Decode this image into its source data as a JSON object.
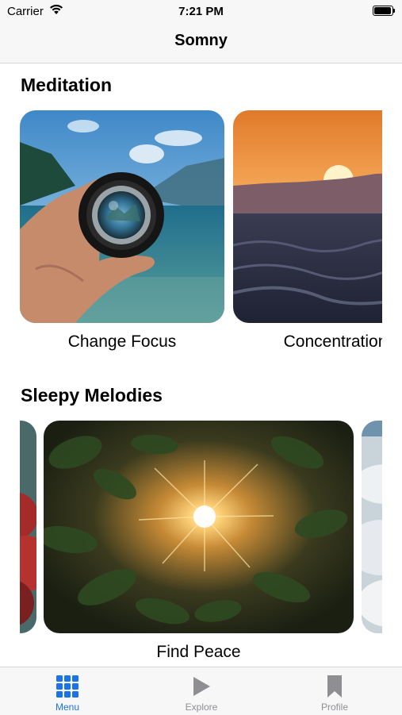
{
  "status_bar": {
    "carrier": "Carrier",
    "time": "7:21 PM"
  },
  "nav": {
    "title": "Somny"
  },
  "sections": [
    {
      "title": "Meditation",
      "cards": [
        {
          "label": "Change Focus",
          "image": "lens-over-lake-photo"
        },
        {
          "label": "Concentration",
          "image": "ocean-sunset-photo"
        }
      ]
    },
    {
      "title": "Sleepy Melodies",
      "cards": [
        {
          "label": "",
          "image": "autumn-tree-photo"
        },
        {
          "label": "Find Peace",
          "image": "sunlight-through-leaves-photo"
        },
        {
          "label": "",
          "image": "clouds-photo"
        }
      ]
    }
  ],
  "tabs": [
    {
      "label": "Menu",
      "icon": "grid-icon",
      "selected": true
    },
    {
      "label": "Explore",
      "icon": "play-icon",
      "selected": false
    },
    {
      "label": "Profile",
      "icon": "bookmark-icon",
      "selected": false
    }
  ],
  "colors": {
    "accent": "#1a73e8",
    "inactive": "#8e8e93",
    "bar_bg": "#f7f7f7"
  }
}
